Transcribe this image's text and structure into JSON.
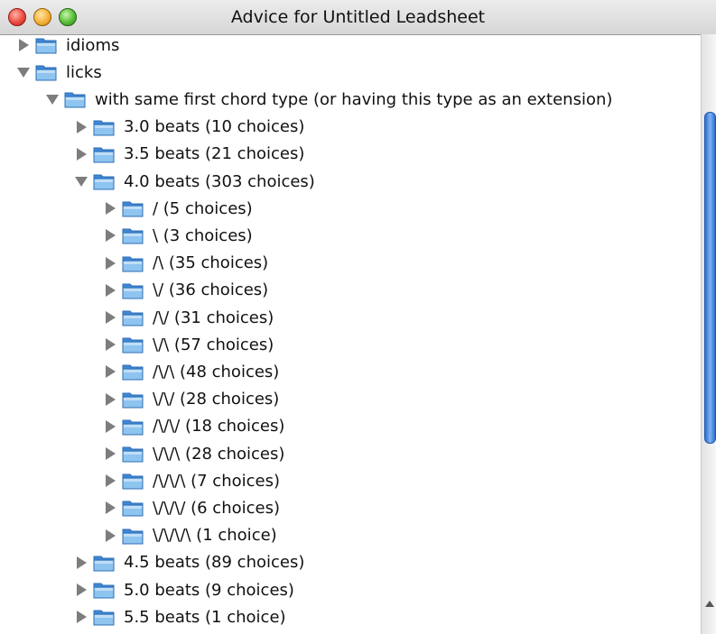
{
  "window": {
    "title": "Advice for Untitled Leadsheet"
  },
  "tree": {
    "rows": [
      {
        "label": "idioms",
        "depth": 0,
        "expanded": false
      },
      {
        "label": "licks",
        "depth": 0,
        "expanded": true
      },
      {
        "label": "with same first chord type (or having this type as an extension)",
        "depth": 1,
        "expanded": true
      },
      {
        "label": "3.0 beats  (10 choices)",
        "depth": 2,
        "expanded": false
      },
      {
        "label": "3.5 beats  (21 choices)",
        "depth": 2,
        "expanded": false
      },
      {
        "label": "4.0 beats  (303 choices)",
        "depth": 2,
        "expanded": true
      },
      {
        "label": "/ (5 choices)",
        "depth": 3,
        "expanded": false
      },
      {
        "label": "\\ (3 choices)",
        "depth": 3,
        "expanded": false
      },
      {
        "label": "/\\ (35 choices)",
        "depth": 3,
        "expanded": false
      },
      {
        "label": "\\/ (36 choices)",
        "depth": 3,
        "expanded": false
      },
      {
        "label": "/\\/ (31 choices)",
        "depth": 3,
        "expanded": false
      },
      {
        "label": "\\/\\ (57 choices)",
        "depth": 3,
        "expanded": false
      },
      {
        "label": "/\\/\\ (48 choices)",
        "depth": 3,
        "expanded": false
      },
      {
        "label": "\\/\\/ (28 choices)",
        "depth": 3,
        "expanded": false
      },
      {
        "label": "/\\/\\/ (18 choices)",
        "depth": 3,
        "expanded": false
      },
      {
        "label": "\\/\\/\\ (28 choices)",
        "depth": 3,
        "expanded": false
      },
      {
        "label": "/\\/\\/\\ (7 choices)",
        "depth": 3,
        "expanded": false
      },
      {
        "label": "\\/\\/\\/ (6 choices)",
        "depth": 3,
        "expanded": false
      },
      {
        "label": "\\/\\/\\/\\ (1 choice)",
        "depth": 3,
        "expanded": false
      },
      {
        "label": "4.5 beats  (89 choices)",
        "depth": 2,
        "expanded": false
      },
      {
        "label": "5.0 beats  (9 choices)",
        "depth": 2,
        "expanded": false
      },
      {
        "label": "5.5 beats  (1 choice)",
        "depth": 2,
        "expanded": false
      }
    ]
  },
  "scrollbar": {
    "visible_fraction": 0.59,
    "scroll_position": 0.34
  },
  "colors": {
    "folder": "#8ec4f0",
    "folder_dark": "#3f87d6",
    "thumb": "#2c6fd1"
  }
}
